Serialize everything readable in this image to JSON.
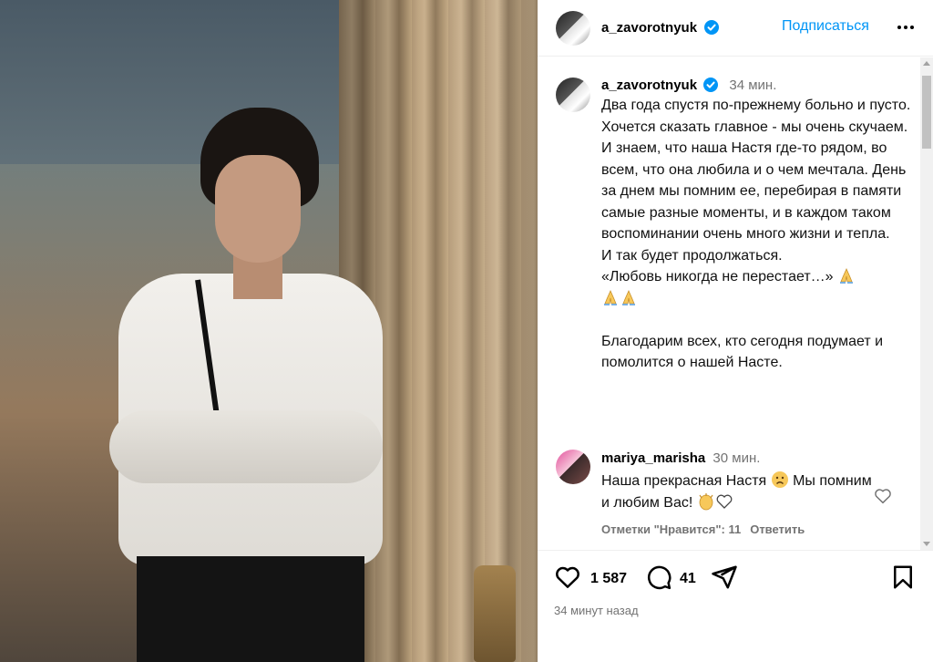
{
  "header": {
    "username": "a_zavorotnyuk",
    "follow_label": "Подписаться"
  },
  "caption": {
    "username": "a_zavorotnyuk",
    "time": "34 мин.",
    "text": "Два года спустя по-прежнему больно и пусто. Хочется сказать главное - мы очень скучаем. И знаем, что наша Настя где-то рядом, во всем, что она любила и о чем мечтала. День за днем мы помним ее, перебирая в памяти самые разные моменты, и в каждом таком воспоминании очень много жизни и тепла.\nИ так будет продолжаться.\n«Любовь никогда не перестает…»",
    "text_after": "Благодарим всех, кто сегодня подумает и помолится о нашей Насте.",
    "emojis": [
      "folded-hands",
      "folded-hands",
      "folded-hands"
    ]
  },
  "comment": {
    "username": "mariya_marisha",
    "time": "30 мин.",
    "text_part1": "Наша прекрасная Настя",
    "text_part2": "Мы помним и любим Вас!",
    "likes_label": "Отметки \"Нравится\": 11",
    "reply_label": "Ответить"
  },
  "footer": {
    "likes_count": "1 587",
    "comments_count": "41",
    "posted_ago": "34 минут назад"
  },
  "colors": {
    "link_blue": "#0095f6",
    "verified_blue": "#0095f6",
    "muted": "#737373"
  },
  "icons": [
    "verified-icon",
    "more-options-icon",
    "heart-icon",
    "comment-icon",
    "share-icon",
    "bookmark-icon",
    "folded-hands-emoji",
    "sad-face-emoji",
    "clapping-hands-emoji",
    "white-heart-emoji"
  ]
}
